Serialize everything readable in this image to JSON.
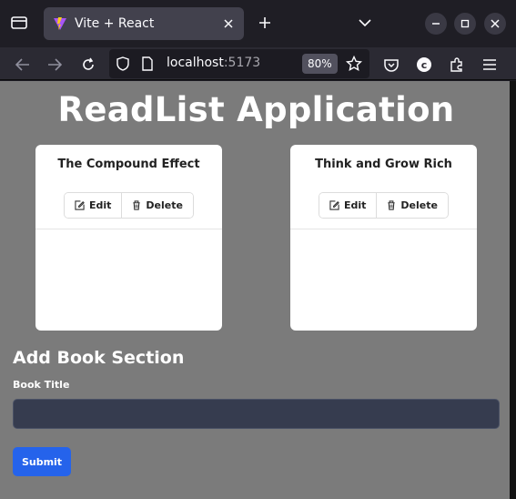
{
  "browser": {
    "tab_title": "Vite + React",
    "url_host": "localhost",
    "url_port": ":5173",
    "zoom": "80%"
  },
  "app": {
    "title": "ReadList Application",
    "books": [
      {
        "title": "The Compound Effect",
        "edit_label": "Edit",
        "delete_label": "Delete"
      },
      {
        "title": "Think and Grow Rich",
        "edit_label": "Edit",
        "delete_label": "Delete"
      }
    ],
    "add_section": {
      "heading": "Add Book Section",
      "field_label": "Book Title",
      "input_value": "",
      "submit_label": "Submit"
    }
  },
  "colors": {
    "page_bg": "#7b7b7b",
    "card_bg": "#ffffff",
    "submit_bg": "#2563eb",
    "input_bg": "#363c4f"
  }
}
